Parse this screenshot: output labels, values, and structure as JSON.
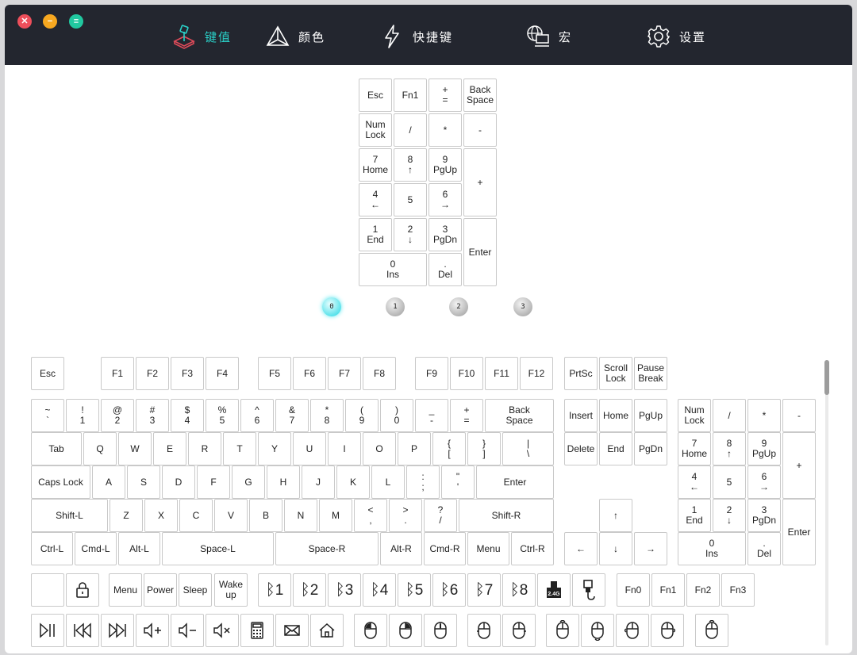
{
  "window": {
    "controls": [
      {
        "name": "close-button",
        "glyph": "✕",
        "color": "#ee4f5b"
      },
      {
        "name": "minimize-button",
        "glyph": "−",
        "color": "#f7a820"
      },
      {
        "name": "menu-button",
        "glyph": "≡",
        "color": "#21c8a0"
      }
    ]
  },
  "nav": [
    {
      "label": "键值",
      "icon": "joystick-icon",
      "active": true
    },
    {
      "label": "颜色",
      "icon": "color-triangle-icon",
      "active": false
    },
    {
      "label": "快捷键",
      "icon": "lightning-icon",
      "active": false
    },
    {
      "label": "宏",
      "icon": "computer-globe-icon",
      "active": false
    },
    {
      "label": "设置",
      "icon": "gear-icon",
      "active": false
    }
  ],
  "colors": {
    "accent": "#2ad1c9",
    "titlebar": "#23262f"
  },
  "numpad_preview": [
    "Esc",
    "Fn1",
    "+\n=",
    "Back\nSpace",
    "Num\nLock",
    "/",
    "*",
    "-",
    "7\nHome",
    "8\n↑",
    "9\nPgUp",
    "+",
    "4\n←",
    "5",
    "6\n→",
    "1\nEnd",
    "2\n↓",
    "3\nPgDn",
    "Enter",
    "0\nIns",
    ".\nDel"
  ],
  "layers": [
    {
      "label": "0",
      "active": true
    },
    {
      "label": "1",
      "active": false
    },
    {
      "label": "2",
      "active": false
    },
    {
      "label": "3",
      "active": false
    }
  ],
  "keyboard": {
    "function_row": [
      "Esc",
      "F1",
      "F2",
      "F3",
      "F4",
      "F5",
      "F6",
      "F7",
      "F8",
      "F9",
      "F10",
      "F11",
      "F12",
      "PrtSc",
      "Scroll\nLock",
      "Pause\nBreak"
    ],
    "number_row": [
      "~\n`",
      "!\n1",
      "@\n2",
      "#\n3",
      "$\n4",
      "%\n5",
      "^\n6",
      "&\n7",
      "*\n8",
      "(\n9",
      ")\n0",
      "_\n-",
      "+\n=",
      "Back\nSpace"
    ],
    "tab_row": [
      "Tab",
      "Q",
      "W",
      "E",
      "R",
      "T",
      "Y",
      "U",
      "I",
      "O",
      "P",
      "{\n[",
      "}\n]",
      "|\n\\"
    ],
    "caps_row": [
      "Caps Lock",
      "A",
      "S",
      "D",
      "F",
      "G",
      "H",
      "J",
      "K",
      "L",
      ":\n;",
      "\"\n'",
      "Enter"
    ],
    "shift_row": [
      "Shift-L",
      "Z",
      "X",
      "C",
      "V",
      "B",
      "N",
      "M",
      "<\n,",
      ">\n.",
      "?\n/",
      "Shift-R"
    ],
    "bottom_row": [
      "Ctrl-L",
      "Cmd-L",
      "Alt-L",
      "Space-L",
      "Space-R",
      "Alt-R",
      "Cmd-R",
      "Menu",
      "Ctrl-R"
    ],
    "nav_cluster": [
      "Insert",
      "Home",
      "PgUp",
      "Delete",
      "End",
      "PgDn",
      "↑",
      "←",
      "↓",
      "→"
    ],
    "numpad": [
      "Num\nLock",
      "/",
      "*",
      "-",
      "7\nHome",
      "8\n↑",
      "9\nPgUp",
      "+",
      "4\n←",
      "5",
      "6\n→",
      "1\nEnd",
      "2\n↓",
      "3\nPgDn",
      "Enter",
      "0\nIns",
      ".\nDel"
    ]
  },
  "extras": {
    "row1_text": [
      "Menu",
      "Power",
      "Sleep",
      "Wake\nup"
    ],
    "bluetooth": [
      "1",
      "2",
      "3",
      "4",
      "5",
      "6",
      "7",
      "8"
    ],
    "dongle_label": "2.4G",
    "fn_keys": [
      "Fn0",
      "Fn1",
      "Fn2",
      "Fn3"
    ],
    "row1_icons": [
      "blank-key",
      "lock-icon"
    ],
    "row2_icons": [
      "play-pause-icon",
      "previous-track-icon",
      "next-track-icon",
      "volume-up-icon",
      "volume-down-icon",
      "mute-icon",
      "calculator-icon",
      "mail-icon",
      "home-icon",
      "mouse-left-icon",
      "mouse-right-icon",
      "mouse-middle-icon",
      "mouse-back-icon",
      "mouse-forward-icon",
      "scroll-up-icon",
      "scroll-down-icon",
      "scroll-left-icon",
      "scroll-right-icon",
      "mouse-move-icon"
    ]
  }
}
